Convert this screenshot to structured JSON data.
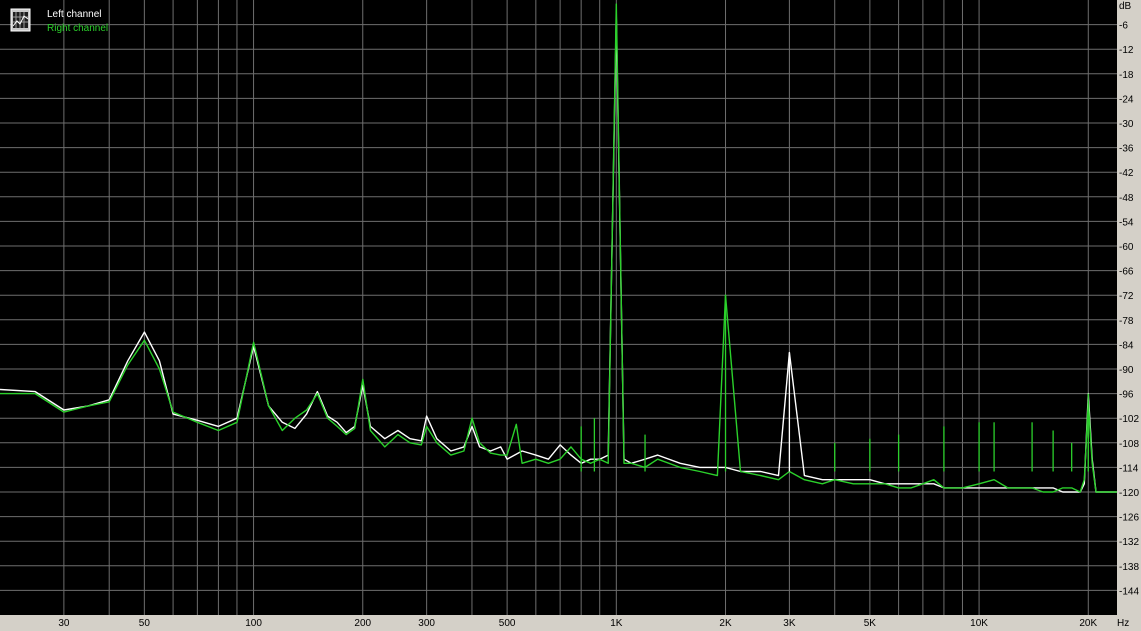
{
  "chart_data": {
    "type": "line",
    "title": "",
    "xlabel": "Hz",
    "ylabel": "dB",
    "x_scale": "log",
    "xlim": [
      20,
      24000
    ],
    "ylim": [
      -150,
      0
    ],
    "grid": true,
    "legend_position": "top-left",
    "background": "#000000",
    "grid_color": "#6e6e6e",
    "x_ticks": [
      {
        "value": 30,
        "label": "30"
      },
      {
        "value": 50,
        "label": "50"
      },
      {
        "value": 100,
        "label": "100"
      },
      {
        "value": 200,
        "label": "200"
      },
      {
        "value": 300,
        "label": "300"
      },
      {
        "value": 500,
        "label": "500"
      },
      {
        "value": 1000,
        "label": "1K"
      },
      {
        "value": 2000,
        "label": "2K"
      },
      {
        "value": 3000,
        "label": "3K"
      },
      {
        "value": 5000,
        "label": "5K"
      },
      {
        "value": 10000,
        "label": "10K"
      },
      {
        "value": 20000,
        "label": "20K"
      }
    ],
    "x_grid_values": [
      30,
      40,
      50,
      60,
      70,
      80,
      90,
      100,
      200,
      300,
      400,
      500,
      600,
      700,
      800,
      900,
      1000,
      2000,
      3000,
      4000,
      5000,
      6000,
      7000,
      8000,
      9000,
      10000,
      20000
    ],
    "y_ticks": [
      -6,
      -12,
      -18,
      -24,
      -30,
      -36,
      -42,
      -48,
      -54,
      -60,
      -66,
      -72,
      -78,
      -84,
      -90,
      -96,
      -102,
      -108,
      -114,
      -120,
      -126,
      -132,
      -138,
      -144
    ],
    "y_tick_labels": [
      "-6",
      "-12",
      "-18",
      "-24",
      "-30",
      "-36",
      "-42",
      "-48",
      "-54",
      "-60",
      "-66",
      "-72",
      "-78",
      "-84",
      "-90",
      "-96",
      "-102",
      "-108",
      "-114",
      "-120",
      "-126",
      "-132",
      "-138",
      "-144"
    ],
    "series": [
      {
        "name": "Left channel",
        "color": "#ffffff",
        "x": [
          20,
          25,
          30,
          35,
          40,
          45,
          50,
          55,
          60,
          70,
          80,
          90,
          100,
          110,
          120,
          130,
          140,
          150,
          160,
          170,
          180,
          190,
          200,
          210,
          230,
          250,
          270,
          290,
          300,
          320,
          350,
          380,
          400,
          420,
          450,
          480,
          500,
          550,
          600,
          650,
          700,
          750,
          800,
          850,
          900,
          950,
          1000,
          1050,
          1100,
          1200,
          1300,
          1500,
          1700,
          1900,
          2000,
          2200,
          2500,
          2800,
          3000,
          3300,
          3700,
          4000,
          4500,
          5000,
          5500,
          6000,
          6500,
          7000,
          7500,
          8000,
          8500,
          9000,
          10000,
          11000,
          12000,
          13000,
          14000,
          15000,
          16000,
          17000,
          18000,
          19000,
          19500,
          20000,
          20500,
          21000,
          22000,
          23000,
          24000
        ],
        "y": [
          -95,
          -95.5,
          -100,
          -99,
          -97.5,
          -88,
          -81,
          -88,
          -101,
          -102.5,
          -104,
          -102,
          -84.5,
          -99,
          -103,
          -104.5,
          -101,
          -95.5,
          -101.5,
          -103,
          -105.5,
          -104,
          -94,
          -104,
          -107,
          -105,
          -107,
          -107.5,
          -101.5,
          -107,
          -110,
          -109,
          -104,
          -109,
          -110,
          -109,
          -112,
          -110,
          -111,
          -112,
          -108.5,
          -111,
          -113,
          -112,
          -112,
          -111,
          -4,
          -112,
          -113,
          -112,
          -111,
          -113,
          -114,
          -114,
          -114,
          -115,
          -115,
          -116,
          -86,
          -116,
          -117,
          -117,
          -117,
          -117,
          -118,
          -118,
          -118,
          -118,
          -118,
          -119,
          -119,
          -119,
          -119,
          -119,
          -119,
          -119,
          -119,
          -119,
          -119,
          -120,
          -120,
          -120,
          -118,
          -96,
          -112,
          -120,
          -120,
          -120,
          -120
        ]
      },
      {
        "name": "Right channel",
        "color": "#2bd02b",
        "x": [
          20,
          25,
          30,
          35,
          40,
          45,
          50,
          55,
          60,
          70,
          80,
          90,
          100,
          110,
          120,
          130,
          140,
          150,
          160,
          170,
          180,
          190,
          200,
          210,
          230,
          250,
          270,
          290,
          300,
          320,
          350,
          380,
          400,
          420,
          450,
          480,
          500,
          530,
          550,
          600,
          650,
          700,
          750,
          800,
          850,
          900,
          950,
          1000,
          1050,
          1100,
          1200,
          1300,
          1500,
          1700,
          1900,
          2000,
          2200,
          2500,
          2800,
          3000,
          3300,
          3700,
          4000,
          4500,
          5000,
          5500,
          6000,
          6500,
          7000,
          7500,
          8000,
          8500,
          9000,
          10000,
          11000,
          12000,
          13000,
          14000,
          15000,
          16000,
          17000,
          18000,
          19000,
          19500,
          20000,
          20500,
          21000,
          22000,
          23000,
          24000
        ],
        "y": [
          -96,
          -96,
          -100.5,
          -99,
          -98,
          -89,
          -83,
          -90,
          -100.5,
          -103,
          -105,
          -103,
          -83.5,
          -99,
          -105,
          -102,
          -100,
          -96,
          -102,
          -104,
          -106,
          -104.5,
          -92.5,
          -105,
          -109,
          -106,
          -108,
          -108.5,
          -104,
          -108,
          -111,
          -110,
          -102,
          -108,
          -110.5,
          -111,
          -111,
          -103.5,
          -113,
          -112,
          -113,
          -112,
          -109,
          -112,
          -113,
          -112,
          -113,
          -1,
          -113,
          -113,
          -114,
          -112,
          -114,
          -115,
          -116,
          -72,
          -115,
          -116,
          -117,
          -115,
          -117,
          -118,
          -117,
          -118,
          -118,
          -118,
          -119,
          -119,
          -118,
          -117,
          -119,
          -119,
          -119,
          -118,
          -117,
          -119,
          -119,
          -119,
          -120,
          -120,
          -119,
          -119,
          -120,
          -117,
          -98,
          -113,
          -120,
          -120,
          -120,
          -120
        ]
      }
    ],
    "spikes": [
      {
        "series": 0,
        "freq": 3000,
        "db": -86
      },
      {
        "series": 1,
        "freq": 2000,
        "db": -72
      },
      {
        "series": 1,
        "freq": 800,
        "db": -104
      },
      {
        "series": 1,
        "freq": 870,
        "db": -102
      },
      {
        "series": 1,
        "freq": 1200,
        "db": -106
      },
      {
        "series": 1,
        "freq": 4000,
        "db": -108
      },
      {
        "series": 1,
        "freq": 5000,
        "db": -107
      },
      {
        "series": 1,
        "freq": 6000,
        "db": -106
      },
      {
        "series": 1,
        "freq": 8000,
        "db": -104
      },
      {
        "series": 1,
        "freq": 10000,
        "db": -103
      },
      {
        "series": 1,
        "freq": 11000,
        "db": -103
      },
      {
        "series": 1,
        "freq": 14000,
        "db": -103
      },
      {
        "series": 1,
        "freq": 16000,
        "db": -105
      },
      {
        "series": 1,
        "freq": 18000,
        "db": -108
      },
      {
        "series": 1,
        "freq": 20000,
        "db": -96
      }
    ]
  }
}
